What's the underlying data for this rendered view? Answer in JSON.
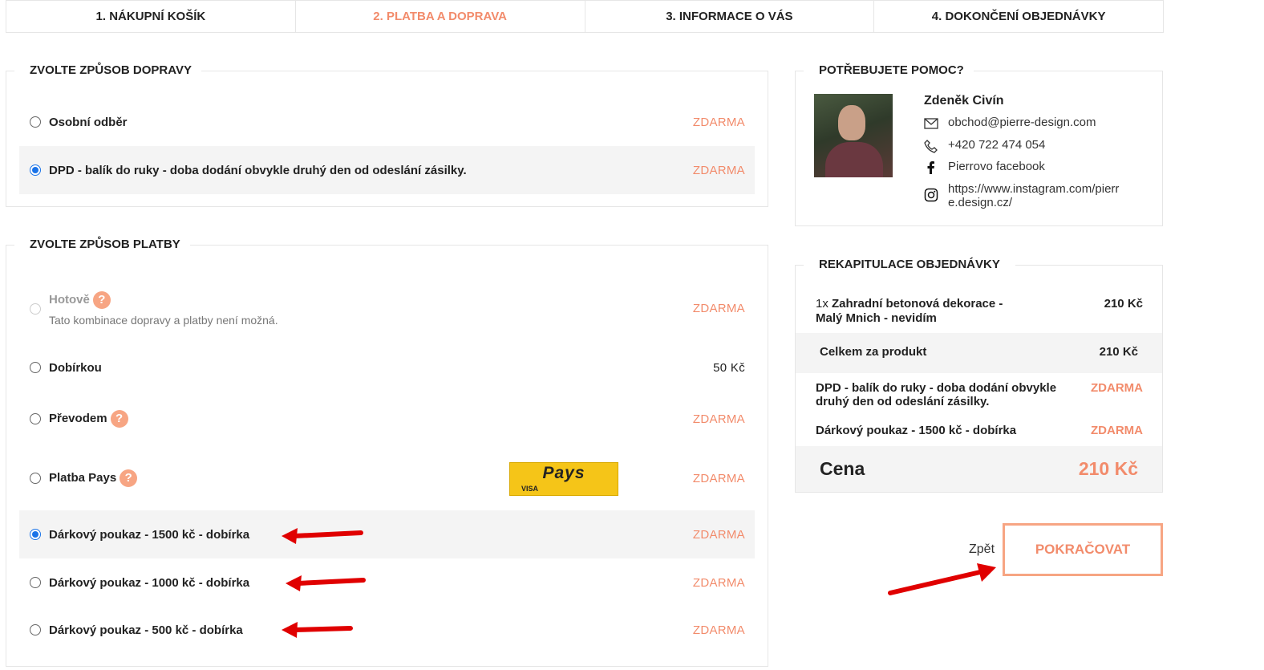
{
  "steps": [
    "1. NÁKUPNÍ KOŠÍK",
    "2. PLATBA A DOPRAVA",
    "3. INFORMACE O VÁS",
    "4. DOKONČENÍ OBJEDNÁVKY"
  ],
  "shipping": {
    "title": "ZVOLTE ZPŮSOB DOPRAVY",
    "options": [
      {
        "label": "Osobní odběr",
        "price": "ZDARMA"
      },
      {
        "label": "DPD - balík do ruky - doba dodání obvykle druhý den od odeslání zásilky.",
        "price": "ZDARMA"
      }
    ]
  },
  "payment": {
    "title": "ZVOLTE ZPŮSOB PLATBY",
    "options": [
      {
        "label": "Hotově",
        "sub": "Tato kombinace dopravy a platby není možná.",
        "price": "ZDARMA"
      },
      {
        "label": "Dobírkou",
        "price": "50 Kč"
      },
      {
        "label": "Převodem",
        "price": "ZDARMA"
      },
      {
        "label": "Platba Pays",
        "price": "ZDARMA"
      },
      {
        "label": "Dárkový poukaz - 1500 kč - dobírka",
        "price": "ZDARMA"
      },
      {
        "label": "Dárkový poukaz - 1000 kč - dobírka",
        "price": "ZDARMA"
      },
      {
        "label": "Dárkový poukaz - 500 kč - dobírka",
        "price": "ZDARMA"
      }
    ],
    "pays_logo": {
      "title": "Pays",
      "sub": "VISA"
    },
    "help_mark": "?"
  },
  "help": {
    "title": "POTŘEBUJETE POMOC?",
    "name": "Zdeněk Civín",
    "email": "obchod@pierre-design.com",
    "phone": "+420 722 474 054",
    "facebook": "Pierrovo facebook",
    "instagram": "https://www.instagram.com/pierre.design.cz/"
  },
  "recap": {
    "title": "REKAPITULACE OBJEDNÁVKY",
    "item_qty": "1x",
    "item_name": "Zahradní betonová dekorace - Malý Mnich - nevidím",
    "item_price": "210 Kč",
    "subtotal_label": "Celkem za produkt",
    "subtotal_value": "210 Kč",
    "shipping_label": "DPD - balík do ruky - doba dodání obvykle druhý den od odeslání zásilky.",
    "shipping_value": "ZDARMA",
    "payment_label": "Dárkový poukaz - 1500 kč - dobírka",
    "payment_value": "ZDARMA",
    "total_label": "Cena",
    "total_value": "210 Kč"
  },
  "actions": {
    "back": "Zpět",
    "continue": "POKRAČOVAT"
  },
  "colors": {
    "accent": "#f28b6b",
    "selected_radio": "#1a73e8",
    "arrow": "#e00000"
  }
}
